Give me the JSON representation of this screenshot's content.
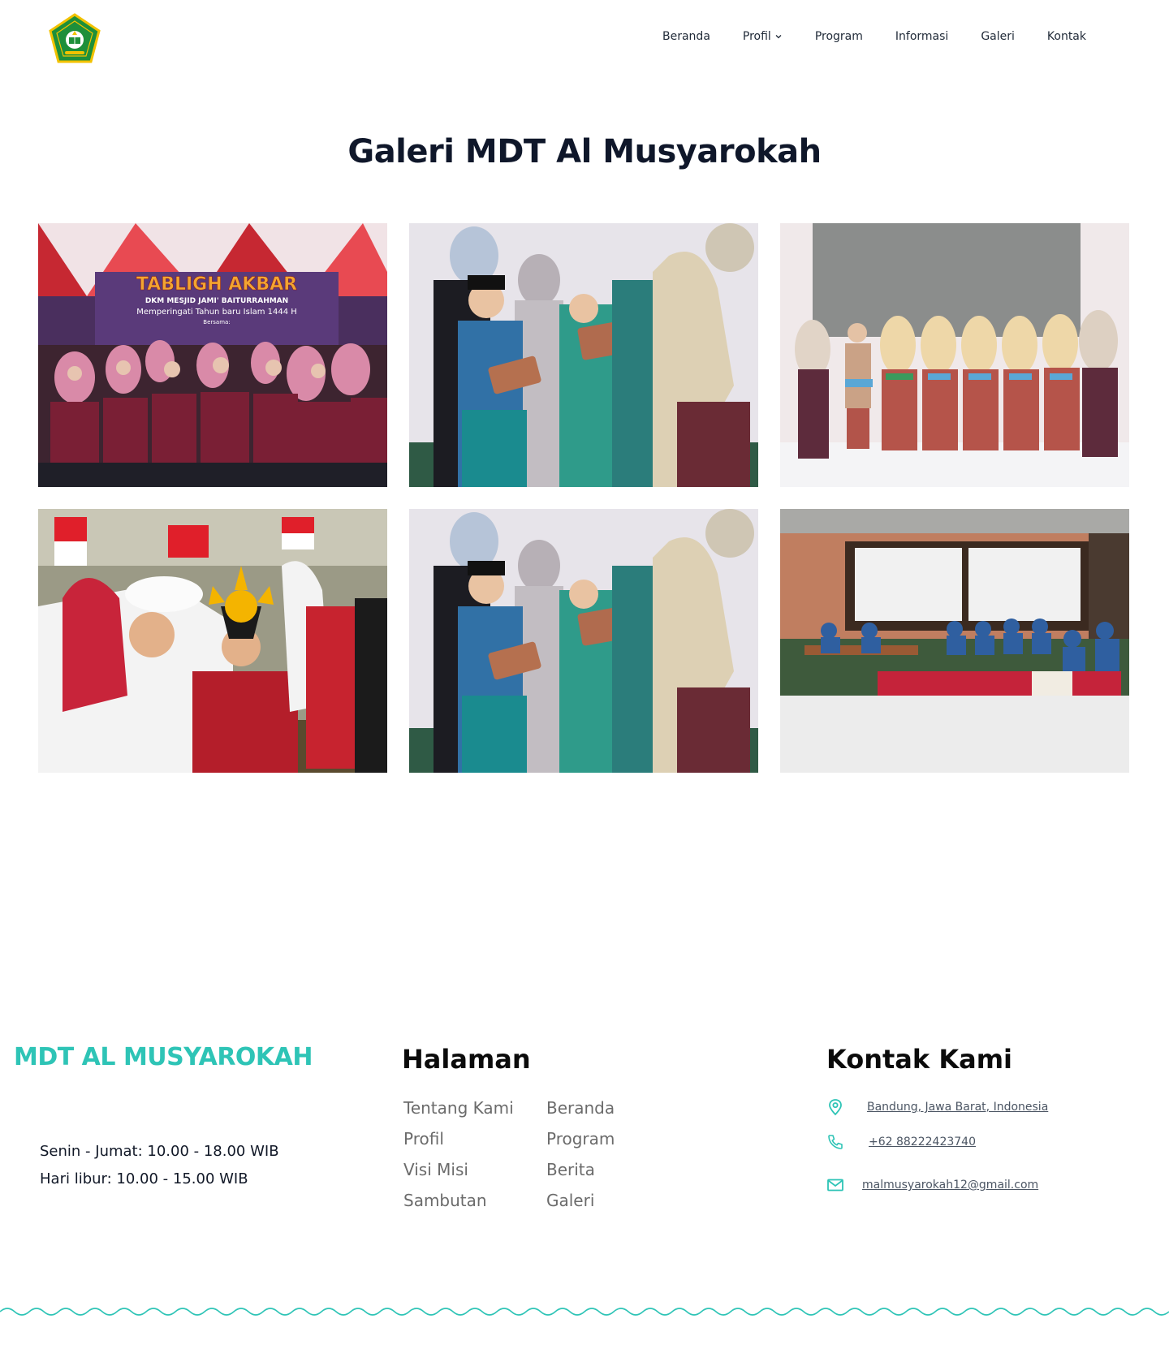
{
  "header": {
    "logo_alt": "Logo Madrasah",
    "nav": [
      {
        "label": "Beranda"
      },
      {
        "label": "Profil",
        "has_dropdown": true
      },
      {
        "label": "Program"
      },
      {
        "label": "Informasi"
      },
      {
        "label": "Galeri"
      },
      {
        "label": "Kontak"
      }
    ]
  },
  "gallery": {
    "title": "Galeri MDT Al Musyarokah",
    "photos": [
      {
        "scene": "tabligh-akbar-group",
        "banner_title": "TABLIGH AKBAR",
        "banner_line1": "DKM MESJID JAMI' BAITURRAHMAN",
        "banner_line2": "Memperingati Tahun baru Islam 1444 H",
        "banner_line3": "Bersama:"
      },
      {
        "scene": "award-ceremony"
      },
      {
        "scene": "students-with-prizes"
      },
      {
        "scene": "independence-day-celebration"
      },
      {
        "scene": "award-ceremony"
      },
      {
        "scene": "classroom-study"
      }
    ]
  },
  "footer": {
    "brand": "MDT AL MUSYAROKAH",
    "hours": [
      "Senin - Jumat: 10.00 - 18.00 WIB",
      "Hari libur: 10.00 - 15.00 WIB"
    ],
    "pages_heading": "Halaman",
    "pages": [
      "Tentang Kami",
      "Beranda",
      "Profil",
      "Program",
      "Visi Misi",
      "Berita",
      "Sambutan",
      "Galeri"
    ],
    "contact_heading": "Kontak Kami",
    "contact": {
      "address": "Bandung, Jawa Barat, Indonesia",
      "phone": "+62 88222423740",
      "email": "malmusyarokah12@gmail.com"
    }
  },
  "colors": {
    "accent": "#2ec4b6",
    "heading": "#0f172a",
    "link": "#6b6b6b",
    "logo_green": "#1e8f3a",
    "logo_gold": "#f2c200"
  },
  "icons": [
    "chevron-down-icon",
    "map-pin-icon",
    "phone-icon",
    "mail-icon"
  ]
}
